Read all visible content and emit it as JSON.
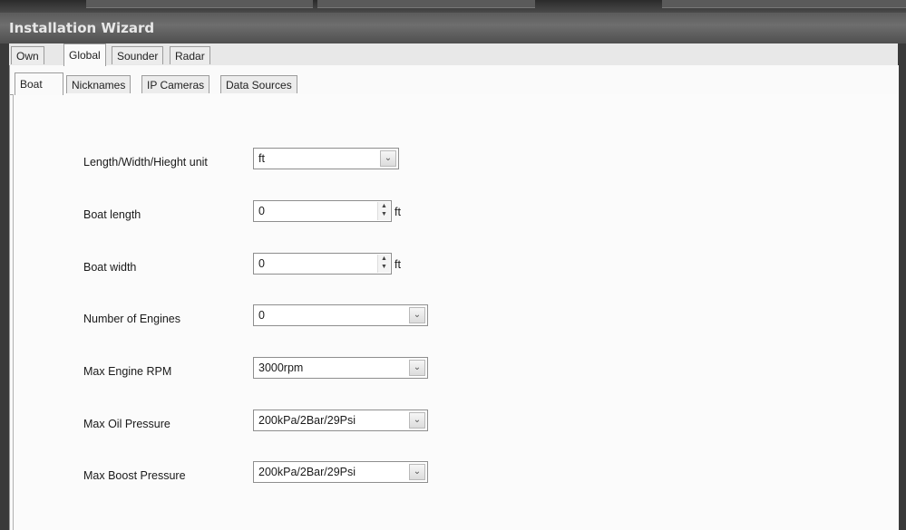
{
  "window": {
    "title": "Installation Wizard"
  },
  "outer_tabs": [
    "Own",
    "Global",
    "Sounder",
    "Radar"
  ],
  "outer_active": "Global",
  "inner_tabs": [
    "Boat",
    "Nicknames",
    "IP Cameras",
    "Data Sources"
  ],
  "inner_active": "Boat",
  "form": {
    "unit": {
      "label": "Length/Width/Hieght unit",
      "value": "ft"
    },
    "boat_length": {
      "label": "Boat length",
      "value": "0",
      "unit": "ft"
    },
    "boat_width": {
      "label": "Boat width",
      "value": "0",
      "unit": "ft"
    },
    "engines": {
      "label": "Number of Engines",
      "value": "0"
    },
    "max_rpm": {
      "label": "Max Engine RPM",
      "value": "3000rpm"
    },
    "max_oil": {
      "label": "Max Oil Pressure",
      "value": "200kPa/2Bar/29Psi"
    },
    "max_boost": {
      "label": "Max Boost Pressure",
      "value": "200kPa/2Bar/29Psi"
    }
  },
  "icons": {
    "dropdown": "chevron-down-icon",
    "spinner": "spinner-updown-icon"
  }
}
